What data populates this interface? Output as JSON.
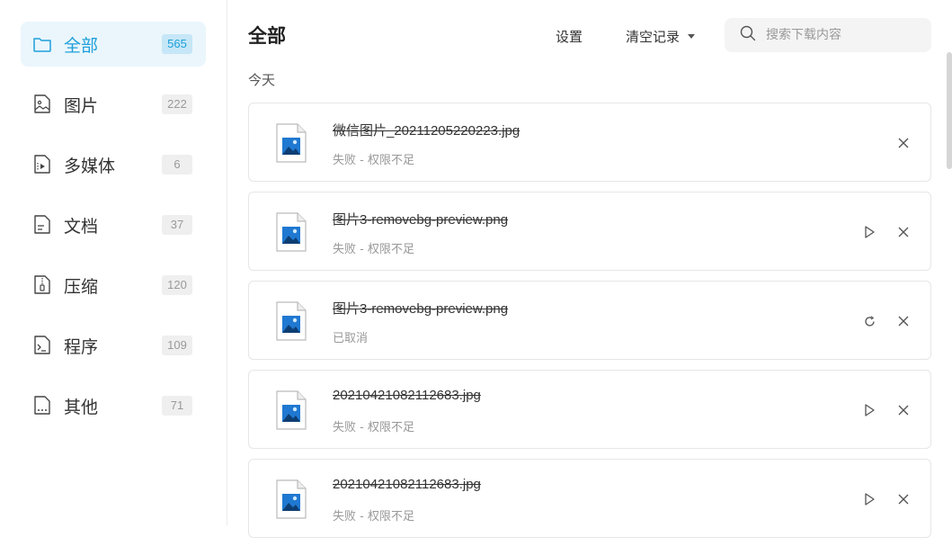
{
  "sidebar": {
    "items": [
      {
        "label": "全部",
        "count": "565",
        "icon": "folder-icon"
      },
      {
        "label": "图片",
        "count": "222",
        "icon": "image-icon"
      },
      {
        "label": "多媒体",
        "count": "6",
        "icon": "video-icon"
      },
      {
        "label": "文档",
        "count": "37",
        "icon": "document-icon"
      },
      {
        "label": "压缩",
        "count": "120",
        "icon": "archive-icon"
      },
      {
        "label": "程序",
        "count": "109",
        "icon": "terminal-icon"
      },
      {
        "label": "其他",
        "count": "71",
        "icon": "other-file-icon"
      }
    ]
  },
  "header": {
    "title": "全部",
    "settings_label": "设置",
    "clear_label": "清空记录",
    "search_placeholder": "搜索下载内容"
  },
  "date_group": "今天",
  "downloads": [
    {
      "name": "微信图片_20211205220223.jpg",
      "status": "失败 - 权限不足",
      "actions": [
        "close-icon"
      ]
    },
    {
      "name": "图片3-removebg-preview.png",
      "status": "失败 - 权限不足",
      "actions": [
        "resume-icon",
        "close-icon"
      ]
    },
    {
      "name": "图片3-removebg-preview.png",
      "status": "已取消",
      "actions": [
        "retry-icon",
        "close-icon"
      ]
    },
    {
      "name": "20210421082112683.jpg",
      "status": "失败 - 权限不足",
      "actions": [
        "resume-icon",
        "close-icon"
      ]
    },
    {
      "name": "20210421082112683.jpg",
      "status": "失败 - 权限不足",
      "actions": [
        "resume-icon",
        "close-icon"
      ]
    }
  ],
  "colors": {
    "accent": "#1e9fd9",
    "active_bg": "#eaf6fc",
    "badge_active_bg": "#c6e7f7"
  }
}
